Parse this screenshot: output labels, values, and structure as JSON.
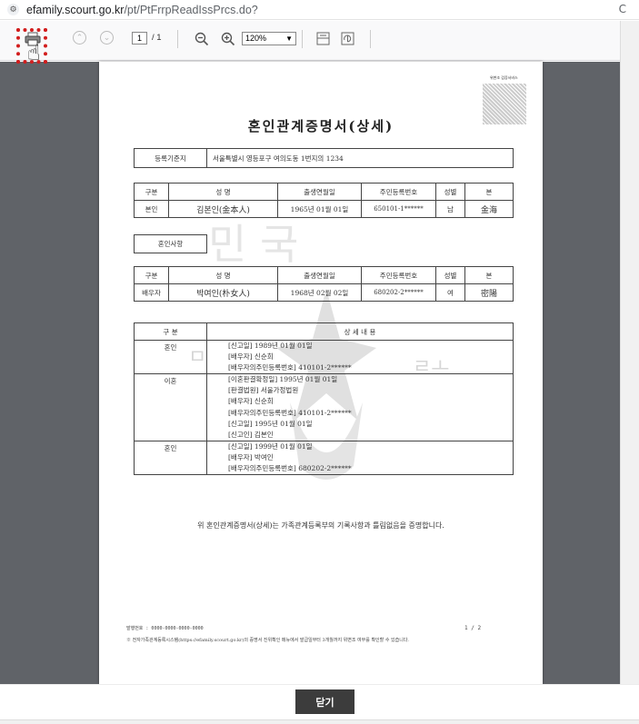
{
  "browser": {
    "url_host": "efamily.scourt.go.kr",
    "url_path": "/pt/PtFrrpReadIssPrcs.do?",
    "right_glyph": "C"
  },
  "toolbar": {
    "page_current": "1",
    "page_total": "/ 1",
    "zoom": "120%",
    "icons": [
      "print-icon",
      "page-up-icon",
      "page-down-icon",
      "zoom-out-icon",
      "zoom-in-icon",
      "fit-page-icon",
      "rotate-icon"
    ]
  },
  "doc": {
    "qr_label": "위변조 검증서비스",
    "title": "혼인관계증명서(상세)",
    "reg": {
      "label": "등록기준지",
      "value": "서울특별시 영등포구 여의도동 1번지의 1234"
    },
    "self_headers": [
      "구분",
      "성 명",
      "출생연월일",
      "주민등록번호",
      "성별",
      "본"
    ],
    "self_row": [
      "본인",
      "김본인(金本人)",
      "1965년 01월 01일",
      "650101-1******",
      "남",
      "金海"
    ],
    "marriage_section": "혼인사항",
    "spouse_headers": [
      "구분",
      "성 명",
      "출생연월일",
      "주민등록번호",
      "성별",
      "본"
    ],
    "spouse_row": [
      "배우자",
      "박여인(朴女人)",
      "1968년 02월 02일",
      "680202-2******",
      "여",
      "密陽"
    ],
    "detail_headers": [
      "구 분",
      "상 세 내 용"
    ],
    "details": [
      {
        "cat": "혼인",
        "lines": [
          "[신고일]  1989년 01월 01일",
          "[배우자]  신순희",
          "[배우자의주민등록번호]    410101-2******"
        ]
      },
      {
        "cat": "이혼",
        "lines": [
          "[이혼판결확정일]  1995년 01월 01일",
          "[판결법원]  서울가정법원",
          "[배우자]  신순희",
          "[배우자의주민등록번호]    410101-2******",
          "[신고일]  1995년 01월 01일",
          "[신고인]  김본인"
        ]
      },
      {
        "cat": "혼인",
        "lines": [
          "[신고일]  1999년 01월 01일",
          "[배우자]  박여인",
          "[배우자의주민등록번호]    680202-2******"
        ]
      }
    ],
    "certify": "위 혼인관계증명서(상세)는 가족관계등록부의 기록사항과 틀림없음을 증명합니다.",
    "footer_no": "발행번호 : 0000-0000-0000-0000",
    "footer_page": "1  /  2",
    "footer_note": "※ 전자가족관계등록시스템(https://efamily.scourt.go.kr)의 증명서 진위확인 메뉴에서 발급일부터 3개월까지 위변조 여부를 확인할 수 있습니다.",
    "watermark": "민 국"
  },
  "close_label": "닫기"
}
